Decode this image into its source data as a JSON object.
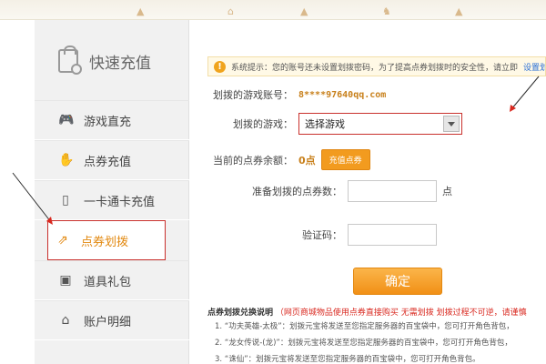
{
  "sidebar": {
    "title": "快速充值",
    "title_icon": "wallet-icon",
    "items": [
      {
        "label": "游戏直充",
        "icon": "gamepad-icon",
        "active": false
      },
      {
        "label": "点券充值",
        "icon": "hand-icon",
        "active": false
      },
      {
        "label": "一卡通卡充值",
        "icon": "card-icon",
        "active": false
      },
      {
        "label": "点券划拨",
        "icon": "transfer-icon",
        "active": true
      },
      {
        "label": "道具礼包",
        "icon": "gift-icon",
        "active": false
      },
      {
        "label": "账户明细",
        "icon": "home-icon",
        "active": false
      }
    ]
  },
  "notice": {
    "text": "系统提示：您的账号还未设置划拨密码，为了提高点券划拨时的安全性，请立即",
    "link": "设置划"
  },
  "form": {
    "account_label": "划拨的游戏账号：",
    "account_value": "8****97640qq.com",
    "game_label": "划拨的游戏：",
    "game_value": "选择游戏",
    "balance_label": "当前的点券余额：",
    "balance_value": "0点",
    "recharge_button": "充值点券",
    "amount_label": "准备划拨的点券数：",
    "amount_unit": "点",
    "captcha_label": "验证码：",
    "confirm_button": "确定"
  },
  "description": {
    "title": "点券划拨兑换说明",
    "red_note": "（网页商城物品使用点券直接购买 无需划拨 划拨过程不可逆，请谨慎",
    "lines": [
      "1. “功夫英雄-太极”：划拨元宝将发送至您指定服务器的百宝袋中，您可打开角色背包，",
      "2. “龙女传说-(龙)”：划拨元宝将发送至您指定服务器的百宝袋中，您可打开角色背包，",
      "3. “诛仙”：划拨元宝将发送至您指定服务器的百宝袋中，您可打开角色背包。"
    ]
  },
  "colors": {
    "accent": "#f29b1f",
    "highlight_border": "#c9302c",
    "warning_red": "#d9281f"
  }
}
